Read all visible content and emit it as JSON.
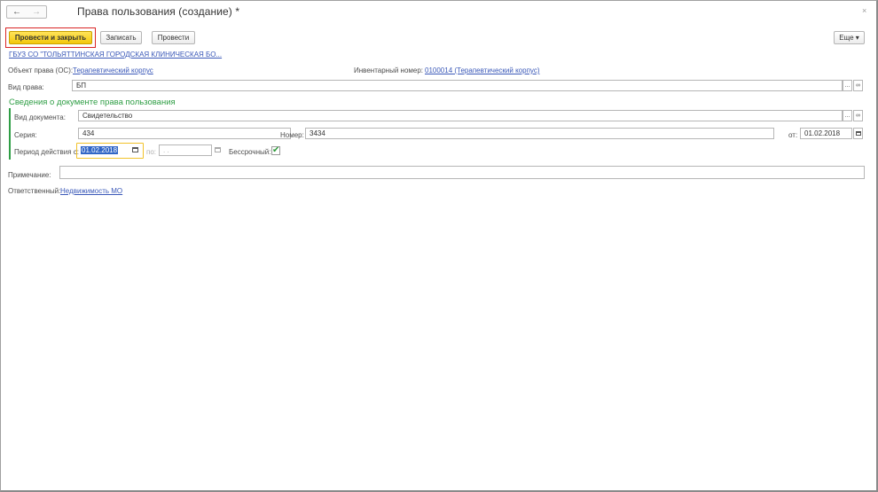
{
  "header": {
    "back_icon": "arrow-left-icon",
    "forward_icon": "arrow-right-icon",
    "title": "Права пользования (создание) *",
    "close_icon": "close-icon"
  },
  "toolbar": {
    "post_and_close": "Провести и закрыть",
    "save": "Записать",
    "post": "Провести",
    "more": "Еще ▾"
  },
  "organization_link": "ГБУЗ СО \"ТОЛЬЯТТИНСКАЯ ГОРОДСКАЯ КЛИНИЧЕСКАЯ БО...",
  "object": {
    "label": "Объект права (ОС):",
    "value": "Терапевтический корпус"
  },
  "inventory": {
    "label": "Инвентарный номер:",
    "value": "0100014 (Терапевтический корпус)"
  },
  "right_type": {
    "label": "Вид права:",
    "value": "БП"
  },
  "document_section": {
    "title": "Сведения о документе права пользования",
    "doc_type_label": "Вид документа:",
    "doc_type_value": "Свидетельство",
    "series_label": "Серия:",
    "series_value": "434",
    "number_label": "Номер:",
    "number_value": "3434",
    "date_label": "от:",
    "date_value": "01.02.2018",
    "period_label": "Период действия с:",
    "period_from": "01.02.2018",
    "period_to_label": "по:",
    "period_to_placeholder": " .  .",
    "indefinite_label": "Бессрочный:",
    "indefinite_checked": "✔"
  },
  "note": {
    "label": "Примечание:",
    "value": ""
  },
  "responsible": {
    "label": "Ответственный:",
    "value": "Недвижимость МО"
  },
  "colors": {
    "accent_yellow": "#f3c80c",
    "section_green": "#2f9e45",
    "link_blue": "#3a58b8",
    "highlight_red": "#d92525",
    "focus_yellow": "#f1c22a"
  }
}
